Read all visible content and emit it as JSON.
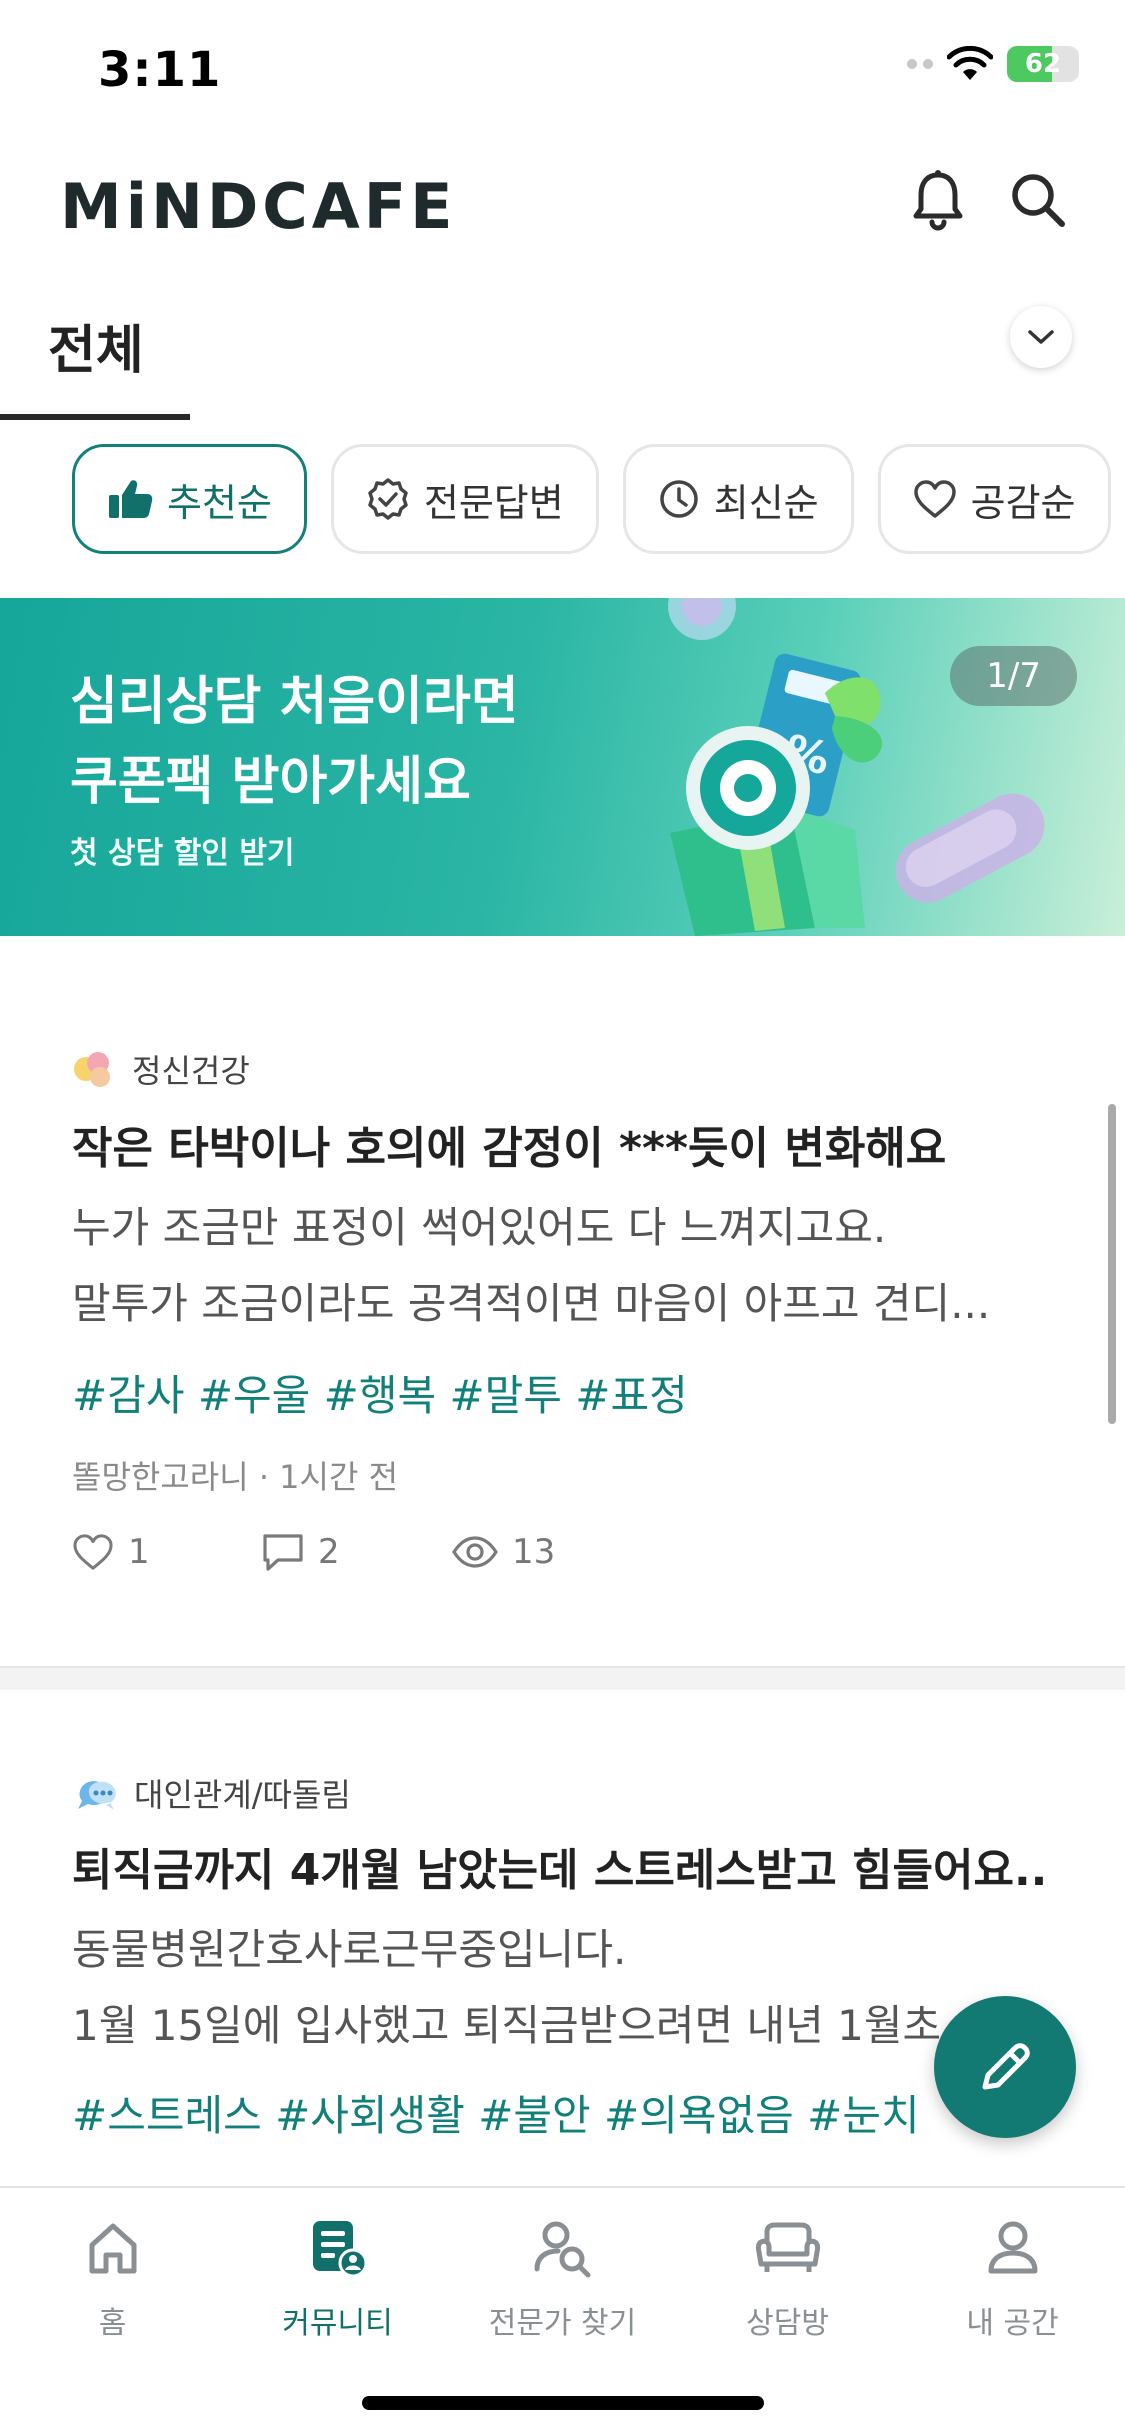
{
  "status_bar": {
    "time": "3:11",
    "battery": "62",
    "battery_level": 0.62
  },
  "header": {
    "logo": "MiNDCAFE",
    "icons": [
      "bell-icon",
      "search-icon"
    ]
  },
  "category": {
    "selected": "전체"
  },
  "filters": [
    {
      "label": "추천순",
      "icon": "thumbs-up-icon",
      "active": true
    },
    {
      "label": "전문답변",
      "icon": "verified-badge-icon",
      "active": false
    },
    {
      "label": "최신순",
      "icon": "clock-icon",
      "active": false
    },
    {
      "label": "공감순",
      "icon": "heart-icon",
      "active": false
    }
  ],
  "banner": {
    "title_line1": "심리상담 처음이라면",
    "title_line2": "쿠폰팩 받아가세요",
    "subtitle": "첫 상담 할인 받기",
    "counter": "1/7"
  },
  "posts": [
    {
      "category": "정신건강",
      "title": "작은 타박이나 호의에 감정이 ***듯이 변화해요",
      "body_line1": "누가 조금만 표정이 썩어있어도 다 느껴지고요.",
      "body_line2": "말투가 조금이라도 공격적이면 마음이 아프고 견디...",
      "tags": "#감사 #우울 #행복 #말투 #표정",
      "author": "똘망한고라니",
      "time": "1시간 전",
      "likes": "1",
      "comments": "2",
      "views": "13"
    },
    {
      "category": "대인관계/따돌림",
      "title": "퇴직금까지 4개월 남았는데 스트레스받고 힘들어요..",
      "body_line1": "동물병원간호사로근무중입니다.",
      "body_line2": "1월 15일에 입사했고 퇴직금받으려면 내년 1월초",
      "tags": "#스트레스 #사회생활 #불안 #의욕없음 #눈치"
    }
  ],
  "bottom_nav": [
    {
      "label": "홈",
      "icon": "home-icon",
      "active": false
    },
    {
      "label": "커뮤니티",
      "icon": "community-icon",
      "active": true
    },
    {
      "label": "전문가 찾기",
      "icon": "expert-search-icon",
      "active": false
    },
    {
      "label": "상담방",
      "icon": "sofa-icon",
      "active": false
    },
    {
      "label": "내 공간",
      "icon": "person-icon",
      "active": false
    }
  ],
  "colors": {
    "accent": "#11706a",
    "accent_dark": "#127a73",
    "tag": "#11807a"
  }
}
